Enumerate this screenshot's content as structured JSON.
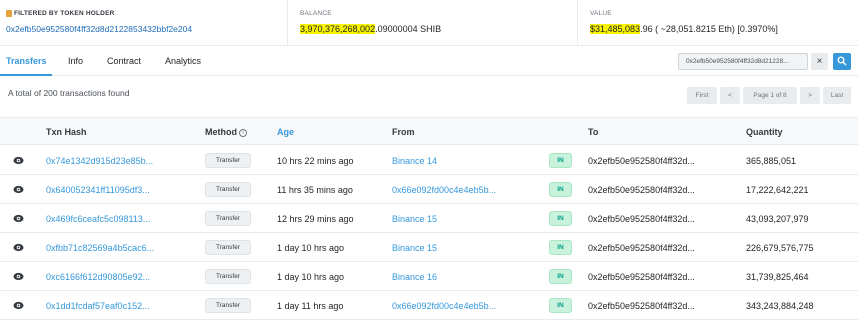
{
  "summary": {
    "filter_label": "FILTERED BY TOKEN HOLDER",
    "filter_address": "0x2efb50e952580f4ff32d8d2122853432bbf2e204",
    "balance_label": "BALANCE",
    "balance_highlight": "3,970,376,268,002",
    "balance_rest": ".09000004 SHIB",
    "value_label": "VALUE",
    "value_highlight": "$31,485,083",
    "value_rest": ".96 ( ~28,051.8215 Eth) [0.3970%]"
  },
  "tabs": [
    "Transfers",
    "Info",
    "Contract",
    "Analytics"
  ],
  "search": {
    "value": "0x2efb50e952580f4ff32d8d21228...",
    "clear_symbol": "×"
  },
  "total_text": "A total of 200 transactions found",
  "pager": {
    "first": "First",
    "prev": "<",
    "page": "Page 1 of 8",
    "next": ">",
    "last": "Last"
  },
  "table": {
    "headers": {
      "hash": "Txn Hash",
      "method": "Method",
      "age": "Age",
      "from": "From",
      "to": "To",
      "quantity": "Quantity"
    },
    "rows": [
      {
        "hash": "0x74e1342d915d23e85b...",
        "method": "Transfer",
        "age": "10 hrs 22 mins ago",
        "from": "Binance 14",
        "direction": "IN",
        "to": "0x2efb50e952580f4ff32d...",
        "quantity": "365,885,051"
      },
      {
        "hash": "0x640052341ff11095df3...",
        "method": "Transfer",
        "age": "11 hrs 35 mins ago",
        "from": "0x66e092fd00c4e4eb5b...",
        "direction": "IN",
        "to": "0x2efb50e952580f4ff32d...",
        "quantity": "17,222,642,221"
      },
      {
        "hash": "0x469fc6ceafc5c098113...",
        "method": "Transfer",
        "age": "12 hrs 29 mins ago",
        "from": "Binance 15",
        "direction": "IN",
        "to": "0x2efb50e952580f4ff32d...",
        "quantity": "43,093,207,979"
      },
      {
        "hash": "0xfbb71c82569a4b5cac6...",
        "method": "Transfer",
        "age": "1 day 10 hrs ago",
        "from": "Binance 15",
        "direction": "IN",
        "to": "0x2efb50e952580f4ff32d...",
        "quantity": "226,679,576,775"
      },
      {
        "hash": "0xc6166f612d90805e92...",
        "method": "Transfer",
        "age": "1 day 10 hrs ago",
        "from": "Binance 16",
        "direction": "IN",
        "to": "0x2efb50e952580f4ff32d...",
        "quantity": "31,739,825,464"
      },
      {
        "hash": "0x1dd1fcdaf57eaf0c152...",
        "method": "Transfer",
        "age": "1 day 11 hrs ago",
        "from": "0x66e092fd00c4e4eb5b...",
        "direction": "IN",
        "to": "0x2efb50e952580f4ff32d...",
        "quantity": "343,243,884,248"
      }
    ]
  },
  "colors": {
    "accent": "#3498db",
    "highlight": "#f8f300",
    "in_badge": "#c9f2dc"
  },
  "icons": {
    "filter": "filter-icon",
    "eye": "eye-icon",
    "search": "search-icon",
    "info": "info-icon"
  }
}
